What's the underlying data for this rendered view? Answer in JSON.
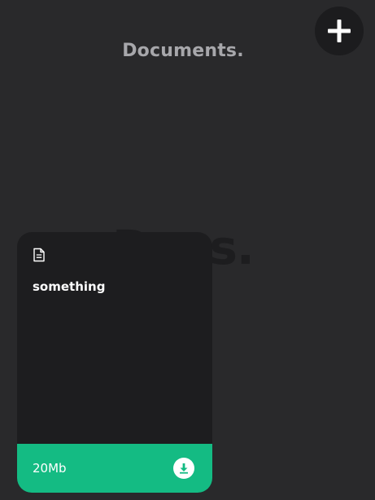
{
  "header": {
    "title": "Documents.",
    "add_icon": "plus-icon"
  },
  "background_label": "Docs.",
  "card": {
    "icon": "file-icon",
    "name": "something",
    "size": "20Mb",
    "download_icon": "download-icon"
  },
  "colors": {
    "background": "#29292b",
    "card": "#1d1d1f",
    "accent": "#14bb83",
    "title": "#a7a7ab"
  }
}
